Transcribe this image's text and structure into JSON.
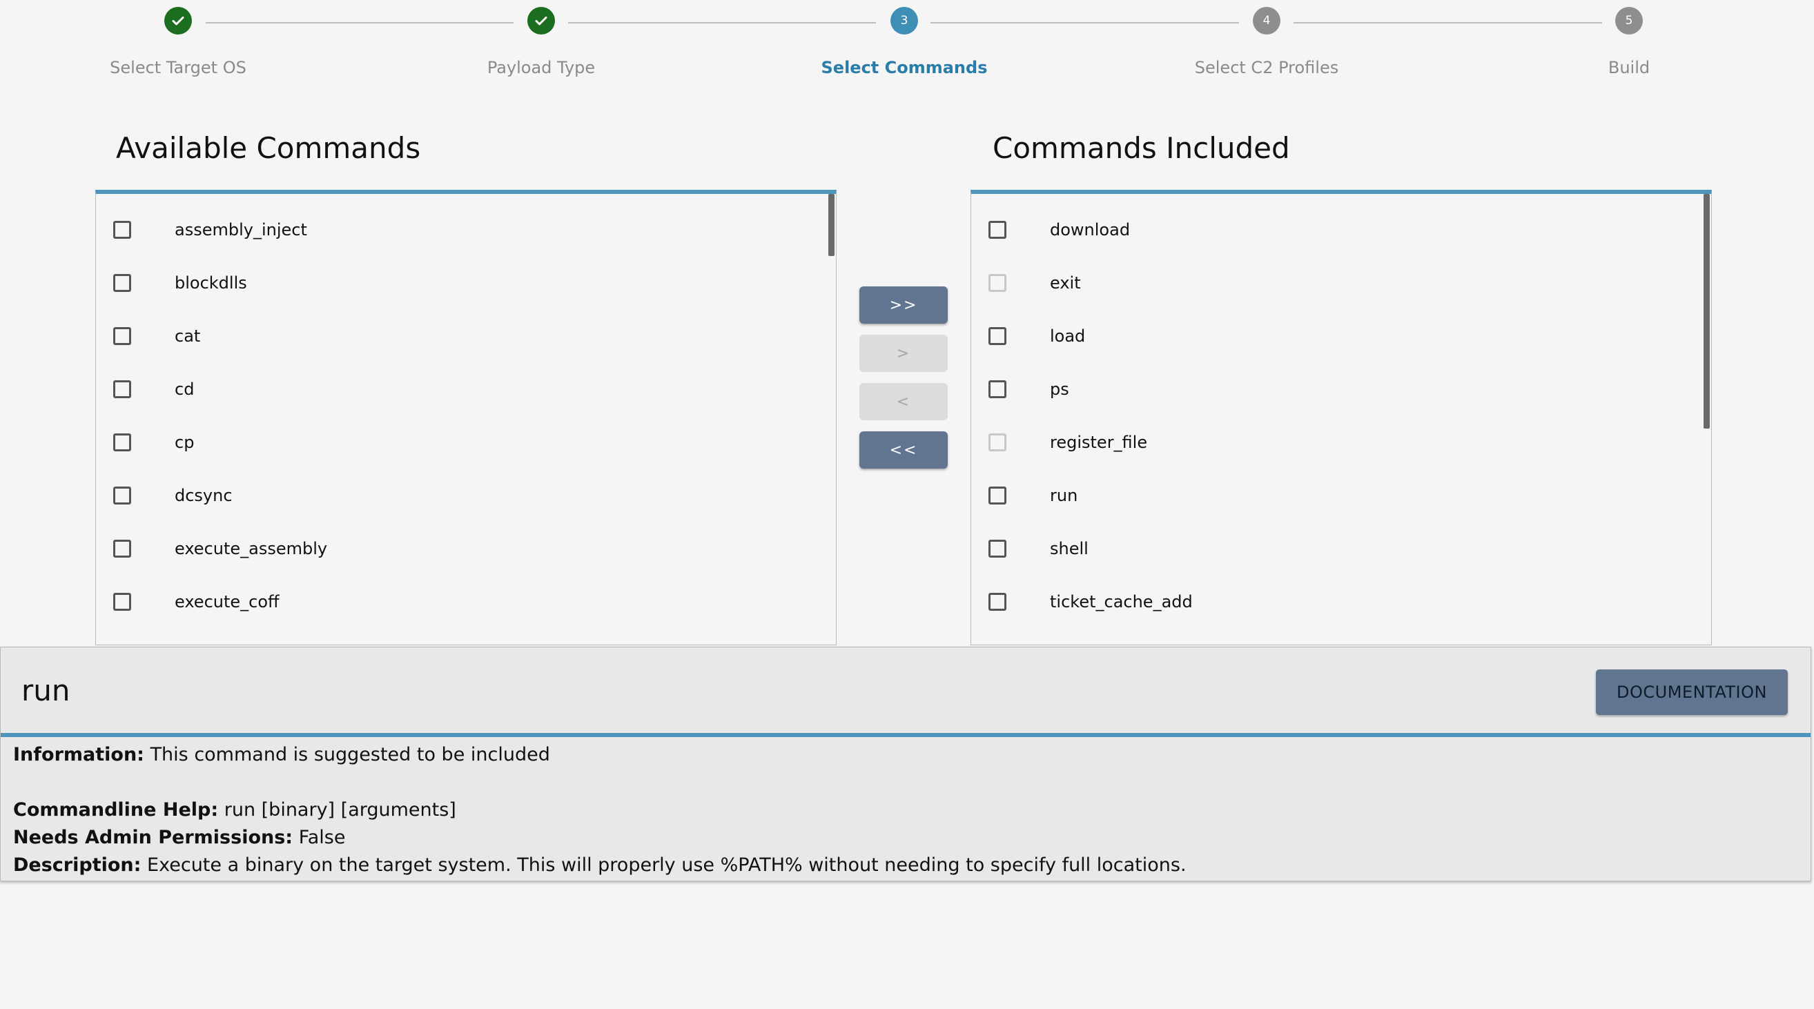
{
  "stepper": {
    "steps": [
      {
        "label": "Select Target OS",
        "state": "done",
        "number": "1"
      },
      {
        "label": "Payload Type",
        "state": "done",
        "number": "2"
      },
      {
        "label": "Select Commands",
        "state": "active",
        "number": "3"
      },
      {
        "label": "Select C2 Profiles",
        "state": "todo",
        "number": "4"
      },
      {
        "label": "Build",
        "state": "todo",
        "number": "5"
      }
    ]
  },
  "available": {
    "title": "Available Commands",
    "items": [
      "assembly_inject",
      "blockdlls",
      "cat",
      "cd",
      "cp",
      "dcsync",
      "execute_assembly",
      "execute_coff"
    ]
  },
  "included": {
    "title": "Commands Included",
    "items": [
      "download",
      "exit",
      "load",
      "ps",
      "register_file",
      "run",
      "shell",
      "ticket_cache_add"
    ],
    "disabled": [
      "exit",
      "register_file"
    ]
  },
  "transfer": {
    "move_all_right": ">>",
    "move_right": ">",
    "move_left": "<",
    "move_all_left": "<<"
  },
  "detail": {
    "title": "run",
    "doc_button": "DOCUMENTATION",
    "information_label": "Information:",
    "information": "This command is suggested to be included",
    "help_label": "Commandline Help:",
    "help": "run [binary] [arguments]",
    "admin_label": "Needs Admin Permissions:",
    "admin": "False",
    "description_label": "Description:",
    "description": "Execute a binary on the target system. This will properly use %PATH% without needing to specify full locations."
  },
  "colors": {
    "accent": "#4f95bb",
    "done": "#1b6e1f",
    "active": "#3f8eb5",
    "button": "#627590"
  }
}
